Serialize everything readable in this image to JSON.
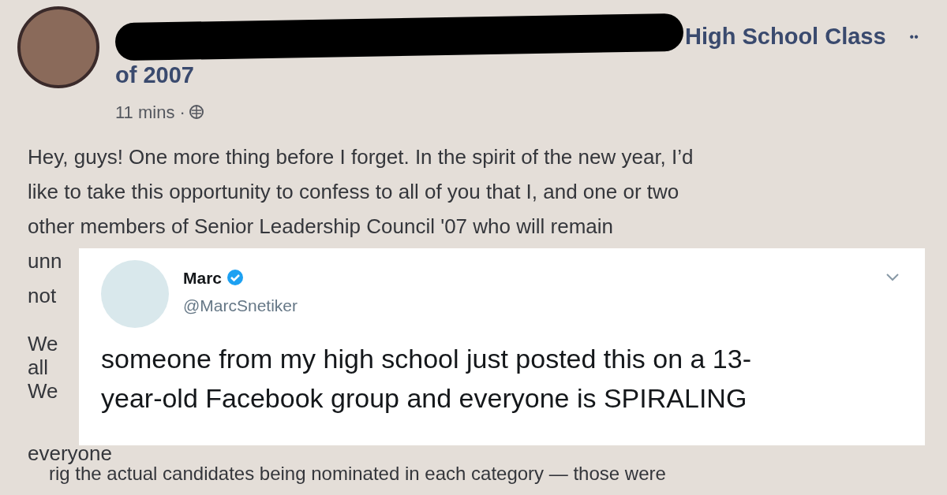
{
  "post": {
    "group_title": [
      "High School Class",
      "of 2007"
    ],
    "time": "11 mins ·",
    "more": "••",
    "lines": [
      "Hey, guys! One more thing before I forget. In the spirit of the new year, I’d",
      "like to take this opportunity to confess to all of you that I, and one or two",
      "other members of Senior Leadership Council '07 who will remain",
      "unn",
      "not"
    ],
    "lines_2": [
      "We",
      "all",
      "We"
    ],
    "cut_line": "everyone",
    "last_line": "rig the actual candidates being nominated in each category — those were"
  },
  "tweet": {
    "name": "Marc",
    "verified": true,
    "handle": "@MarcSnetiker",
    "text": "someone from my high school just posted this on a 13-year-old Facebook group and everyone is SPIRALING"
  }
}
